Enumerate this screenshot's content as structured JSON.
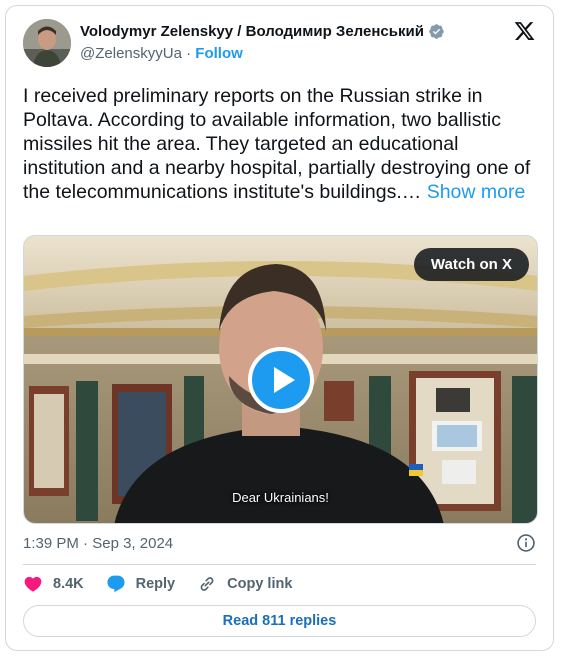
{
  "author": {
    "name": "Volodymyr Zelenskyy / Володимир Зеленський",
    "handle": "@ZelenskyyUa",
    "separator": "·",
    "follow_label": "Follow"
  },
  "tweet": {
    "text": "I received preliminary reports on the Russian strike in Poltava. According to available information, two ballistic missiles hit the area. They targeted an educational institution and a nearby hospital, partially destroying one of the telecommunications institute's buildings.…",
    "show_more_label": "Show more"
  },
  "media": {
    "watch_label": "Watch on X",
    "caption": "Dear Ukrainians!"
  },
  "meta": {
    "time": "1:39 PM",
    "separator": "·",
    "date": "Sep 3, 2024"
  },
  "actions": {
    "likes": "8.4K",
    "reply_label": "Reply",
    "copy_label": "Copy link"
  },
  "read_replies_label": "Read 811 replies",
  "icons": [
    "verified-badge-icon",
    "x-logo-icon",
    "play-icon",
    "info-icon",
    "heart-icon",
    "reply-bubble-icon",
    "link-icon"
  ],
  "colors": {
    "accent": "#1d9bf0",
    "heart": "#f91880",
    "muted": "#536471"
  }
}
